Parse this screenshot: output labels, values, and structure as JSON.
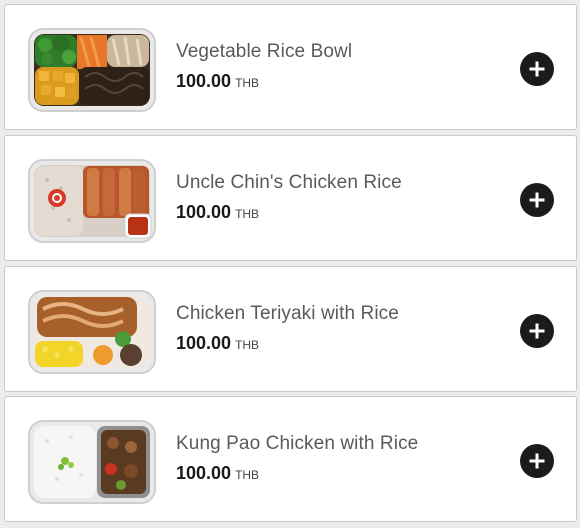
{
  "menu": {
    "items": [
      {
        "name": "Vegetable Rice Bowl",
        "price": "100.00",
        "currency": "THB",
        "image": "vegetable-rice-bowl-photo"
      },
      {
        "name": "Uncle Chin's Chicken Rice",
        "price": "100.00",
        "currency": "THB",
        "image": "chicken-rice-photo"
      },
      {
        "name": "Chicken Teriyaki with Rice",
        "price": "100.00",
        "currency": "THB",
        "image": "chicken-teriyaki-photo"
      },
      {
        "name": "Kung Pao Chicken with Rice",
        "price": "100.00",
        "currency": "THB",
        "image": "kung-pao-chicken-photo"
      }
    ]
  },
  "icons": {
    "add": "plus-circle-icon"
  },
  "colors": {
    "add_button": "#1b1b1b",
    "card_border": "#c9c9c9",
    "price": "#1a1a1a",
    "name": "#5a5a5a"
  }
}
